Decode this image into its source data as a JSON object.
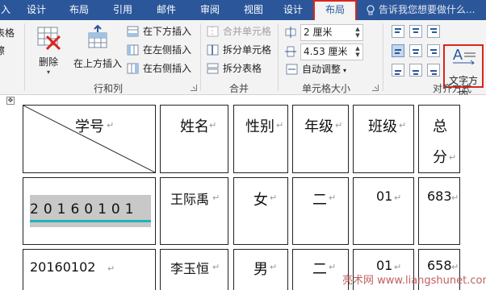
{
  "tabs": [
    {
      "label": "入",
      "active": false
    },
    {
      "label": "设计",
      "active": false
    },
    {
      "label": "布局",
      "active": false
    },
    {
      "label": "引用",
      "active": false
    },
    {
      "label": "邮件",
      "active": false
    },
    {
      "label": "审阅",
      "active": false
    },
    {
      "label": "视图",
      "active": false
    },
    {
      "label": "设计",
      "active": false
    },
    {
      "label": "布局",
      "active": true
    }
  ],
  "tell_me": "告诉我您想要做什么...",
  "ribbon": {
    "partial_left": {
      "line1": "表格",
      "line2": "擦"
    },
    "rows_cols": {
      "delete_label": "删除",
      "insert_above_label": "在上方插入",
      "insert_below_label": "在下方插入",
      "insert_left_label": "在左侧插入",
      "insert_right_label": "在右侧插入",
      "group_label": "行和列"
    },
    "merge": {
      "merge_cells_label": "合并单元格",
      "split_cells_label": "拆分单元格",
      "split_table_label": "拆分表格",
      "group_label": "合并"
    },
    "cell_size": {
      "height_value": "2 厘米",
      "width_value": "4.53 厘米",
      "autofit_label": "自动调整",
      "group_label": "单元格大小"
    },
    "alignment": {
      "text_direction_label": "文字方向",
      "group_label": "对齐方式"
    }
  },
  "table": {
    "header_corner": "学号",
    "headers": [
      "姓名",
      "性别",
      "年级",
      "班级",
      "总"
    ],
    "header_total_line2": "分",
    "rows": [
      {
        "id": "20160101",
        "name": "王际禹",
        "gender": "女",
        "grade": "二",
        "class": "01",
        "total": "683"
      },
      {
        "id": "20160102",
        "name": "李玉恒",
        "gender": "男",
        "grade": "二",
        "class": "01",
        "total": "658"
      }
    ]
  },
  "watermark": "亮术网 www.liangshunet.com",
  "colors": {
    "ribbon_blue": "#2b579a",
    "highlight_red": "#d9261c",
    "selection_gray": "#c8c8c8",
    "underline_teal": "#1fb5b5"
  }
}
